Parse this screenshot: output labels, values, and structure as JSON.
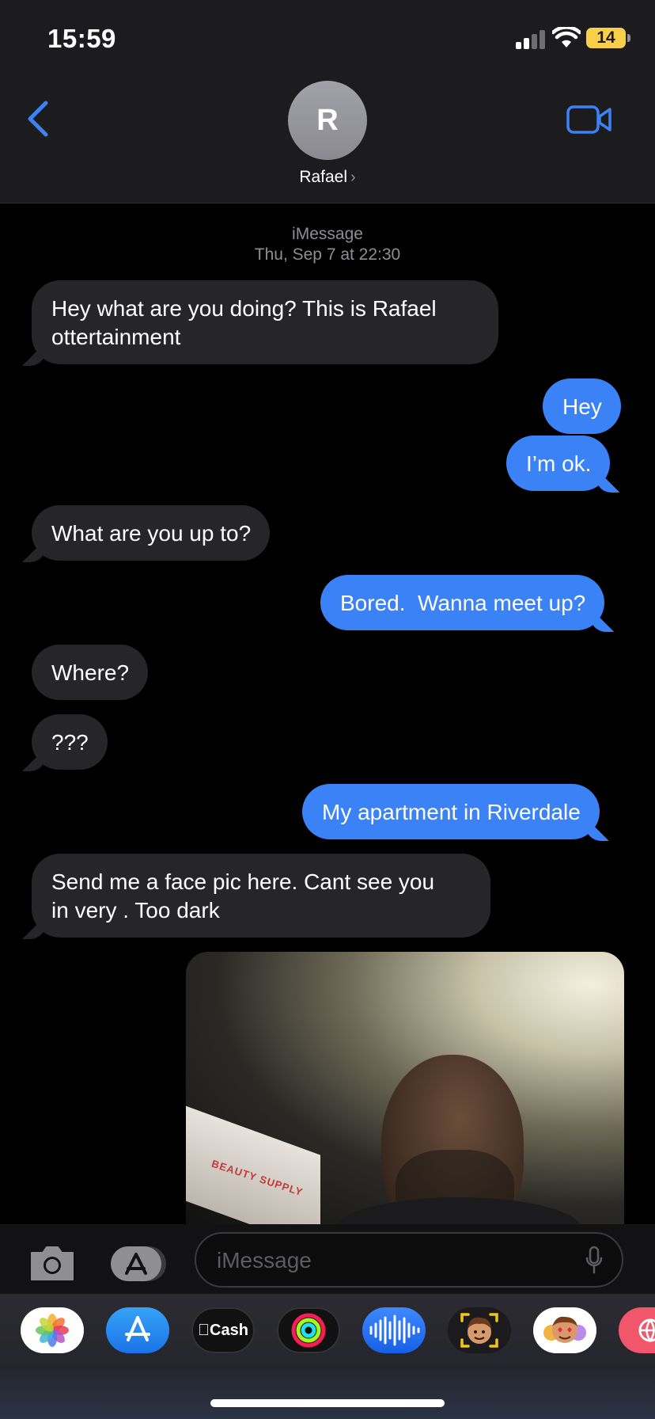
{
  "status_bar": {
    "time": "15:59",
    "battery": "14"
  },
  "header": {
    "avatar_initial": "R",
    "contact_name": "Rafael"
  },
  "thread": {
    "service_label": "iMessage",
    "timestamp": "Thu, Sep 7 at 22:30",
    "messages": [
      {
        "from": "them",
        "text": "Hey what are you doing? This is Rafael\nottertainment"
      },
      {
        "from": "me",
        "text": "Hey"
      },
      {
        "from": "me",
        "text": "I’m ok."
      },
      {
        "from": "them",
        "text": "What are you up to?"
      },
      {
        "from": "me",
        "text": "Bored.  Wanna meet up?"
      },
      {
        "from": "them",
        "text": "Where?"
      },
      {
        "from": "them",
        "text": "???"
      },
      {
        "from": "me",
        "text": "My apartment in Riverdale"
      },
      {
        "from": "them",
        "text": "Send me a face pic here. Cant see you\nin very . Too dark"
      }
    ],
    "photo_sign_text": "BEAUTY SUPPLY"
  },
  "composer": {
    "placeholder": "iMessage"
  },
  "app_strip": [
    {
      "name": "photos-app",
      "icon": "photos-icon"
    },
    {
      "name": "app-store-app",
      "icon": "app-store-icon"
    },
    {
      "name": "apple-cash-app",
      "icon": "cash-icon",
      "label": "Cash"
    },
    {
      "name": "activity-app",
      "icon": "activity-rings-icon"
    },
    {
      "name": "audio-message-app",
      "icon": "waveform-icon"
    },
    {
      "name": "memoji-app",
      "icon": "memoji-icon"
    },
    {
      "name": "stickers-app",
      "icon": "memoji-stickers-icon"
    },
    {
      "name": "web-images-app",
      "icon": "globe-icon"
    }
  ],
  "colors": {
    "accent": "#3b82f6",
    "incoming_bubble": "#262628",
    "outgoing_bubble": "#3b82f6",
    "battery": "#f7cf4a"
  }
}
